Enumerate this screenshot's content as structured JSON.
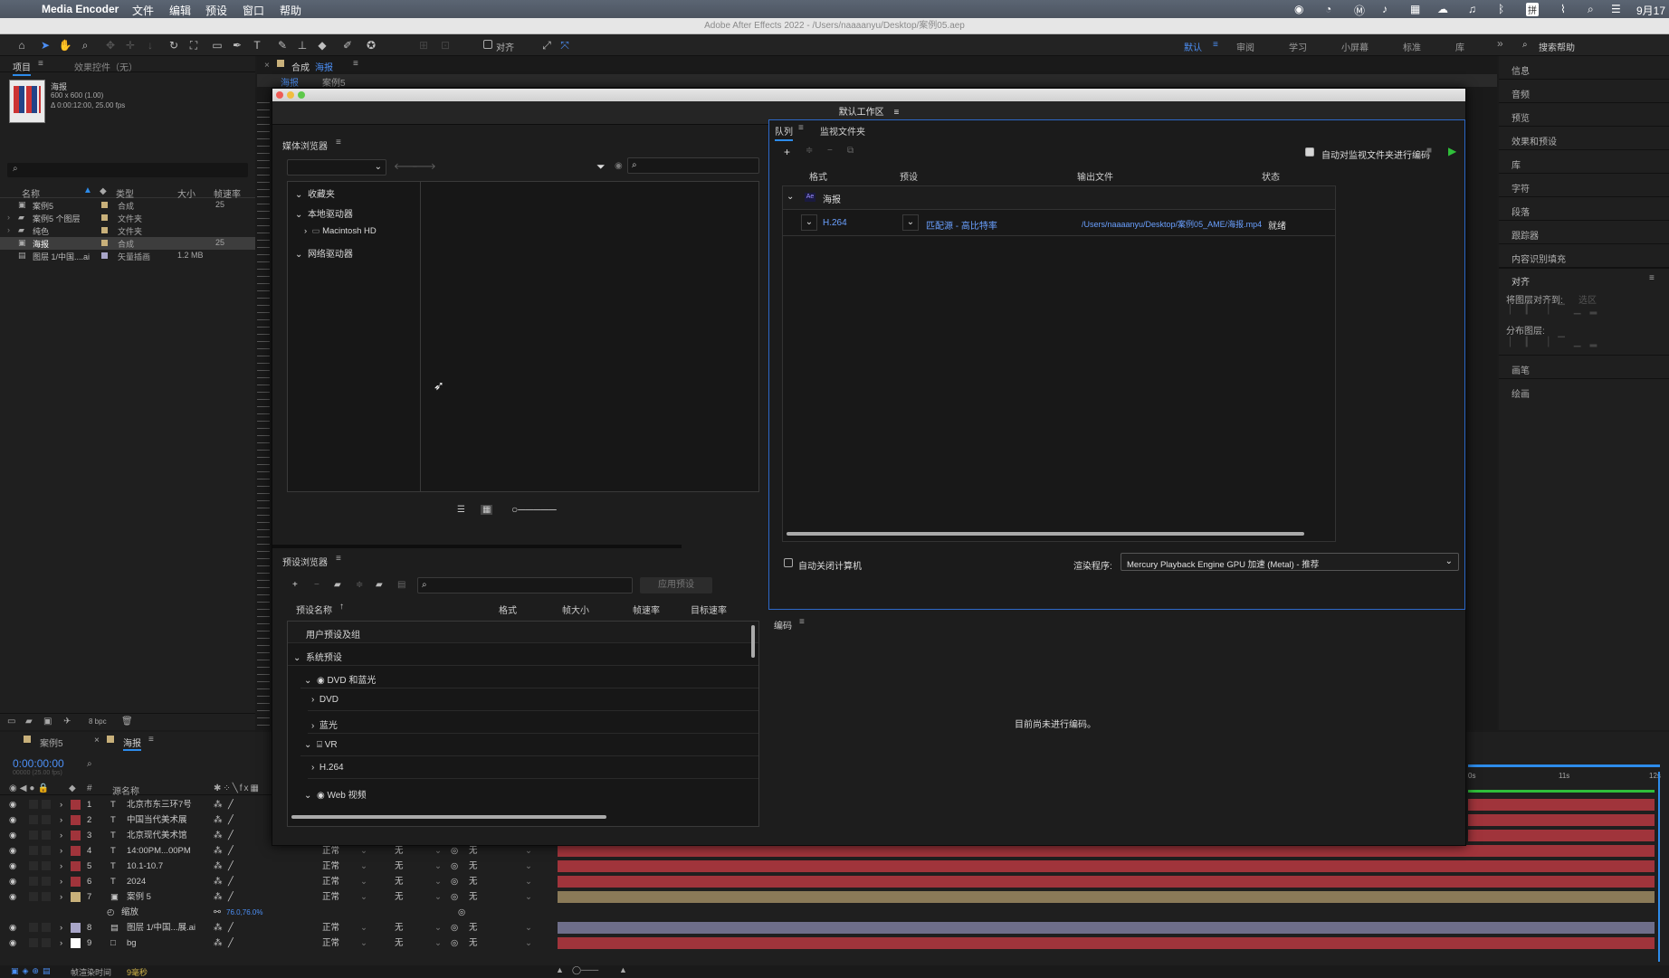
{
  "menubar": {
    "app": "Media Encoder",
    "items": [
      "文件",
      "编辑",
      "预设",
      "窗口",
      "帮助"
    ],
    "date": "9月17"
  },
  "ae": {
    "title": "Adobe After Effects 2022 - /Users/naaaanyu/Desktop/案例05.aep",
    "align_label": "对齐",
    "workspaces": [
      "默认",
      "审阅",
      "学习",
      "小屏幕",
      "标准",
      "库"
    ],
    "search_help": "搜索帮助",
    "project": {
      "tab_project": "项目",
      "tab_effects": "效果控件（无）",
      "thumb_name": "海报",
      "thumb_size": "600 x 600 (1.00)",
      "thumb_dur": "Δ 0:00:12:00, 25.00 fps",
      "cols": [
        "名称",
        "类型",
        "大小",
        "帧速率"
      ],
      "rows": [
        {
          "name": "案例5",
          "type": "合成",
          "size": "",
          "fps": "25"
        },
        {
          "name": "案例5 个图层",
          "type": "文件夹",
          "size": "",
          "fps": ""
        },
        {
          "name": "纯色",
          "type": "文件夹",
          "size": "",
          "fps": ""
        },
        {
          "name": "海报",
          "type": "合成",
          "size": "",
          "fps": "25"
        },
        {
          "name": "图层 1/中国....ai",
          "type": "矢量插画",
          "size": "1.2 MB",
          "fps": ""
        }
      ],
      "bpc": "8 bpc"
    },
    "comp": {
      "tab": "合成",
      "name": "海报",
      "bc": [
        "海报",
        "案例5"
      ]
    },
    "right_panels": [
      "信息",
      "音频",
      "预览",
      "效果和预设",
      "库",
      "字符",
      "段落",
      "跟踪器",
      "内容识别填充"
    ],
    "align": {
      "title": "对齐",
      "align_to": "将图层对齐到:",
      "selection": "选区",
      "distribute": "分布图层:"
    },
    "extra_panels": [
      "画笔",
      "绘画"
    ],
    "timeline": {
      "tabs": [
        "案例5",
        "海报"
      ],
      "time": "0:00:00:00",
      "frames": "00000 (25.00 fps)",
      "col_source": "源名称",
      "layers": [
        {
          "n": "1",
          "t": "T",
          "name": "北京市东三环7号",
          "mode": "",
          "matte": "",
          "parent": ""
        },
        {
          "n": "2",
          "t": "T",
          "name": "中国当代美术展",
          "mode": "",
          "matte": "",
          "parent": ""
        },
        {
          "n": "3",
          "t": "T",
          "name": "北京现代美术馆",
          "mode": "",
          "matte": "",
          "parent": ""
        },
        {
          "n": "4",
          "t": "T",
          "name": "14:00PM...00PM",
          "mode": "正常",
          "matte": "无",
          "parent": "无"
        },
        {
          "n": "5",
          "t": "T",
          "name": "10.1-10.7",
          "mode": "正常",
          "matte": "无",
          "parent": "无"
        },
        {
          "n": "6",
          "t": "T",
          "name": "2024",
          "mode": "正常",
          "matte": "无",
          "parent": "无"
        },
        {
          "n": "7",
          "t": "▣",
          "name": "案例 5",
          "mode": "正常",
          "matte": "无",
          "parent": "无"
        },
        {
          "n": "",
          "t": "",
          "name": "缩放",
          "mode": "76.0,76.0%",
          "matte": "",
          "parent": ""
        },
        {
          "n": "8",
          "t": "▤",
          "name": "图层 1/中国...展.ai",
          "mode": "正常",
          "matte": "无",
          "parent": "无"
        },
        {
          "n": "9",
          "t": "□",
          "name": "bg",
          "mode": "正常",
          "matte": "无",
          "parent": "无"
        }
      ],
      "ruler": [
        "0s",
        "11s",
        "12s"
      ],
      "render_time_label": "帧渲染时间",
      "render_time": "9毫秒"
    }
  },
  "ame": {
    "workspace": "默认工作区",
    "media_browser": {
      "title": "媒体浏览器",
      "tree": [
        "收藏夹",
        "本地驱动器",
        "Macintosh HD",
        "网络驱动器"
      ]
    },
    "preset_browser": {
      "title": "预设浏览器",
      "apply": "应用预设",
      "cols": [
        "预设名称",
        "格式",
        "帧大小",
        "帧速率",
        "目标速率"
      ],
      "tree": [
        "用户预设及组",
        "系统预设",
        "DVD 和蓝光",
        "DVD",
        "蓝光",
        "VR",
        "H.264",
        "Web 视频"
      ]
    },
    "queue": {
      "tab_queue": "队列",
      "tab_watch": "监视文件夹",
      "auto_encode": "自动对监视文件夹进行编码",
      "cols": [
        "格式",
        "预设",
        "输出文件",
        "状态"
      ],
      "group": "海报",
      "item": {
        "format": "H.264",
        "preset": "匹配源 - 高比特率",
        "output": "/Users/naaaanyu/Desktop/案例05_AME/海报.mp4",
        "status": "就绪"
      },
      "auto_shutdown": "自动关闭计算机",
      "renderer_label": "渲染程序:",
      "renderer": "Mercury Playback Engine GPU 加速 (Metal) - 推荐"
    },
    "encoding": {
      "title": "编码",
      "empty": "目前尚未进行编码。"
    }
  },
  "colors": {
    "accent": "#2d8ceb",
    "label_red": "#a0343b",
    "play": "#2fbf3a"
  }
}
